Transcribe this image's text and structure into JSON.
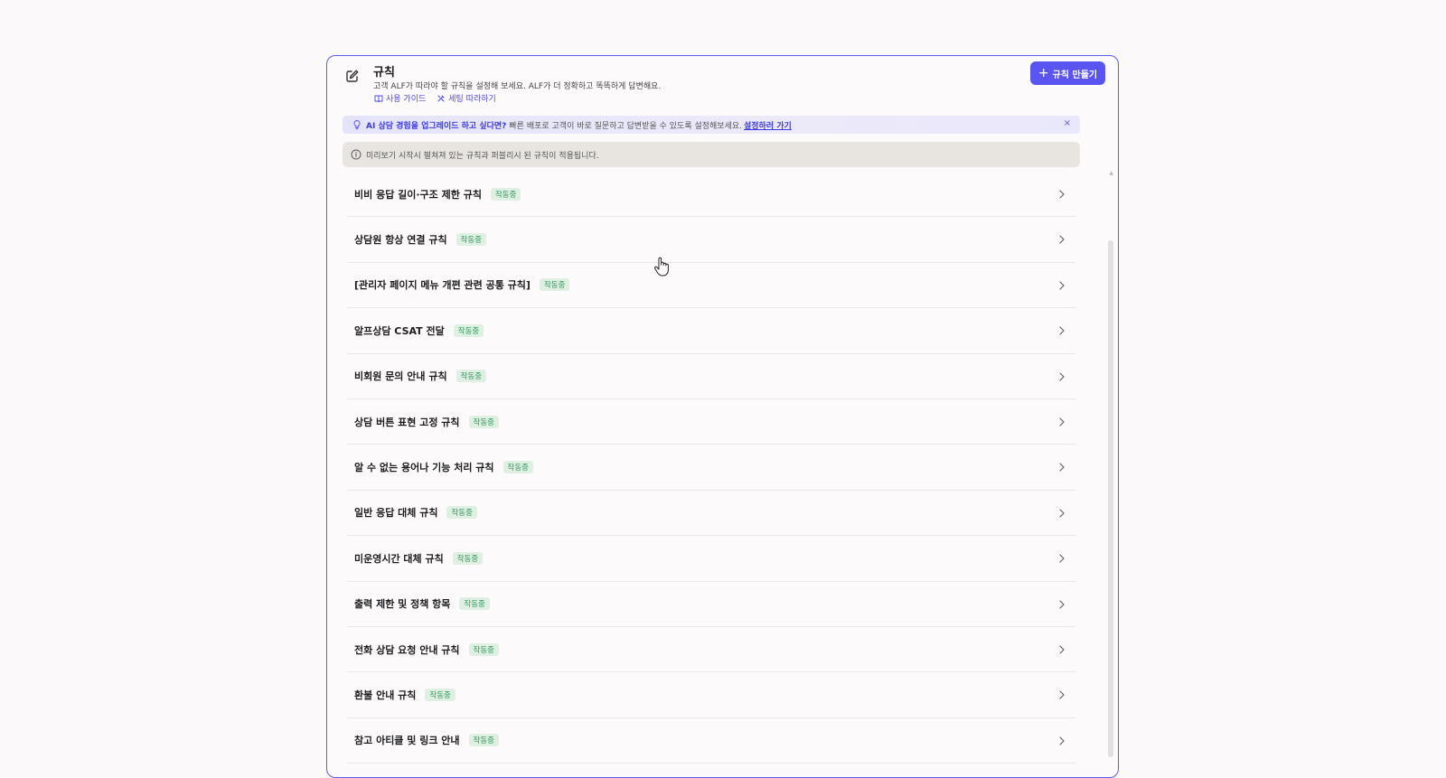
{
  "header": {
    "title": "규칙",
    "subtitle": "고객 ALF가 따라야 할 규칙을 설정해 보세요. ALF가 더 정확하고 똑똑하게 답변해요.",
    "guide_link": "사용 가이드",
    "follow_link": "세팅 따라하기",
    "create_button": "규칙 만들기"
  },
  "promo": {
    "strong": "AI 상담 경험을 업그레이드 하고 싶다면?",
    "body": "빠른 배포로 고객이 바로 질문하고 답변받을 수 있도록 설정해보세요.",
    "link": "설정하러 가기",
    "close": "×"
  },
  "notice": {
    "text": "미리보기 시작시 펼쳐져 있는 규칙과 퍼블리시 된 규칙이 적용됩니다."
  },
  "rules": [
    {
      "name": "비비 응답 길이·구조 제한 규칙",
      "status": "작동중"
    },
    {
      "name": "상담원 항상 연결 규칙",
      "status": "작동중"
    },
    {
      "name": "[관리자 페이지 메뉴 개편 관련 공통 규칙]",
      "status": "작동중"
    },
    {
      "name": "알프상담 CSAT 전달",
      "status": "작동중"
    },
    {
      "name": "비회원 문의 안내 규칙",
      "status": "작동중"
    },
    {
      "name": "상담 버튼 표현 고정 규칙",
      "status": "작동중"
    },
    {
      "name": "알 수 없는 용어나 기능 처리 규칙",
      "status": "작동중"
    },
    {
      "name": "일반 응답 대체 규칙",
      "status": "작동중"
    },
    {
      "name": "미운영시간 대체 규칙",
      "status": "작동중"
    },
    {
      "name": "출력 제한 및 정책 항목",
      "status": "작동중"
    },
    {
      "name": "전화 상담 요청 안내 규칙",
      "status": "작동중"
    },
    {
      "name": "환불 안내 규칙",
      "status": "작동중"
    },
    {
      "name": "참고 아티클 및 링크 안내",
      "status": "작동중"
    }
  ],
  "colors": {
    "accent": "#5a55f0",
    "badge_text": "#2e9b5e",
    "badge_bg": "#dfefe2"
  }
}
